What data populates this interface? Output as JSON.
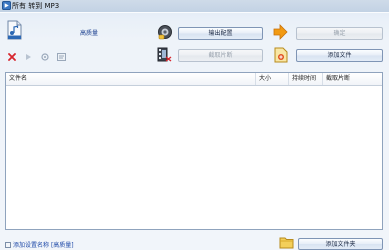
{
  "window": {
    "title": "所有 转到 MP3"
  },
  "toolbar": {
    "quality_label": "高质量",
    "output_config_label": "输出配置",
    "confirm_label": "确定",
    "cut_clip_label": "截取片断",
    "add_file_label": "添加文件"
  },
  "file_table": {
    "columns": [
      "文件名",
      "大小",
      "持续时间",
      "截取片断"
    ],
    "rows": []
  },
  "footer": {
    "add_name_label": "添加设置名称",
    "quality_tag": "[高质量]",
    "add_folder_label": "添加文件夹"
  },
  "icons": {
    "app": "app-icon",
    "audio_file": "audio-file-icon",
    "delete": "delete-icon",
    "play": "play-icon",
    "settings": "settings-icon",
    "info": "info-icon",
    "speaker_output": "speaker-icon",
    "arrow_confirm": "arrow-right-icon",
    "film_cut": "film-cut-icon",
    "add_file": "add-file-icon",
    "add_folder": "add-folder-icon"
  },
  "colors": {
    "accent_orange": "#f29a12",
    "delete_red": "#d7262e",
    "link_blue": "#1e49a8"
  }
}
